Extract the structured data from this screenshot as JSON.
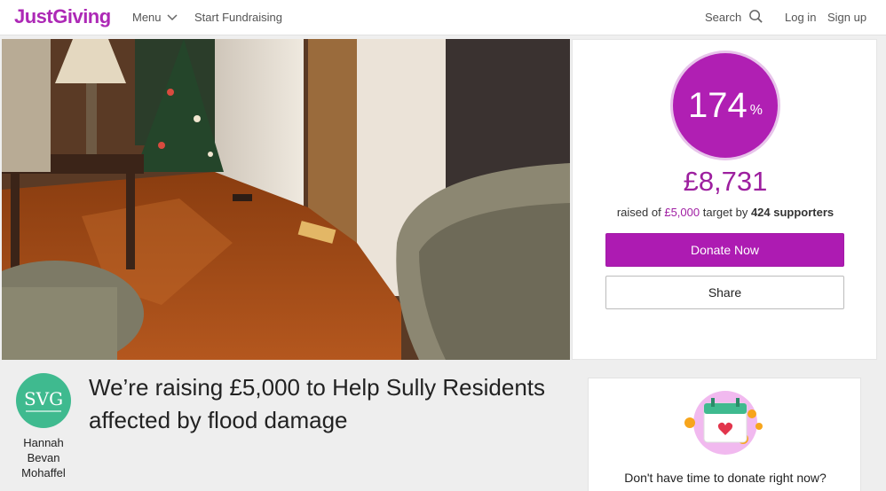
{
  "header": {
    "logo": "JustGiving",
    "menu_label": "Menu",
    "start_label": "Start Fundraising",
    "search_label": "Search",
    "login_label": "Log in",
    "signup_label": "Sign up"
  },
  "colors": {
    "brand": "#ad29b6",
    "donate_button": "#ad1bb2",
    "progress_circle": "#b01fb3",
    "avatar": "#3fba8f"
  },
  "donation": {
    "percent": "174",
    "percent_sign": "%",
    "raised": "£8,731",
    "raised_prefix": "raised of",
    "target": "£5,000",
    "target_suffix": "target by",
    "supporters": "424 supporters",
    "donate_label": "Donate Now",
    "share_label": "Share"
  },
  "fundraiser": {
    "avatar_text": "SVG",
    "owner_name": "Hannah Bevan Mohaffel",
    "headline": "We’re raising £5,000 to Help Sully Residents affected by flood damage"
  },
  "reminder_card": {
    "text": "Don't have time to donate right now?",
    "icon": "calendar-heart-icon"
  },
  "icons": [
    "chevron-down-icon",
    "search-icon",
    "calendar-heart-icon"
  ]
}
